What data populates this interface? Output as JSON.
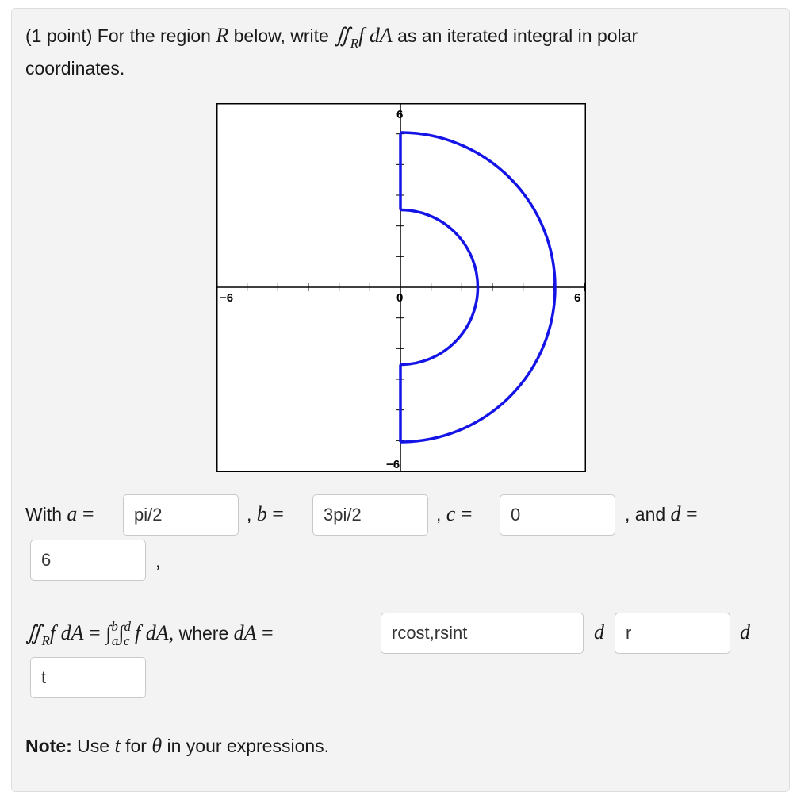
{
  "problem": {
    "prefix": "(1 point) For the region ",
    "region_symbol": "R",
    "mid": " below, write ",
    "integral_expr": "∬",
    "integral_sub": "R",
    "integrand": "f dA",
    "suffix": " as an iterated integral in polar",
    "line2": "coordinates."
  },
  "graph": {
    "tick_labels": {
      "top": "6",
      "bottom": "−6",
      "left": "−6",
      "right": "6",
      "origin": "0"
    },
    "curve_color": "#1414e6",
    "regions": {
      "inner_radius": 3,
      "outer_radius": 6,
      "theta_from_deg": -90,
      "theta_to_deg": 90
    }
  },
  "answers": {
    "with_label": "With ",
    "a_var": "a",
    "eq": " = ",
    "a_value": "pi/2",
    "b_sep": ", ",
    "b_var": "b",
    "b_value": "3pi/2",
    "c_sep": ", ",
    "c_var": "c",
    "c_value": "0",
    "d_sep": ", and ",
    "d_var": "d",
    "d_value": "6",
    "trailing_comma": ","
  },
  "iterated": {
    "lhs_int": "∬",
    "lhs_sub": "R",
    "lhs_integrand": "f dA",
    "equals": " = ",
    "int1": "∫",
    "int1_sup": "b",
    "int1_sub": "a",
    "int2": "∫",
    "int2_sup": "d",
    "int2_sub": "c",
    "integrand": " f dA, ",
    "where": "where ",
    "dA": "dA",
    "eq2": " = ",
    "dA_value": "rcost,rsint",
    "d1": "d",
    "var1_value": "r",
    "d2": "d",
    "var2_value": "t"
  },
  "note": {
    "bold": "Note:",
    "text_a": " Use ",
    "t_var": "t",
    "text_b": " for ",
    "theta": "θ",
    "text_c": " in your expressions."
  }
}
